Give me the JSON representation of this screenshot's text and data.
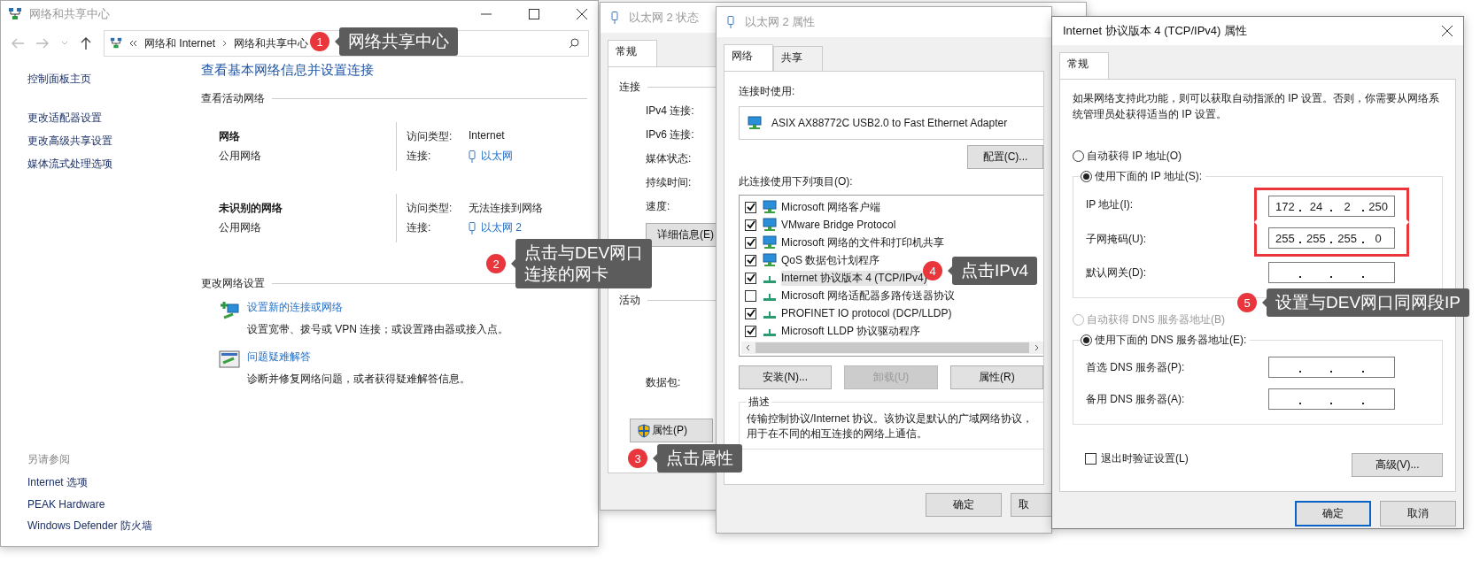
{
  "network_center": {
    "title": "网络和共享中心",
    "breadcrumb": [
      "网络和 Internet",
      "网络和共享中心"
    ],
    "sidebar": {
      "items": [
        "控制面板主页",
        "更改适配器设置",
        "更改高级共享设置",
        "媒体流式处理选项"
      ],
      "see_also_title": "另请参阅",
      "see_also": [
        "Internet 选项",
        "PEAK Hardware",
        "Windows Defender 防火墙"
      ]
    },
    "heading": "查看基本网络信息并设置连接",
    "active_title": "查看活动网络",
    "networks": [
      {
        "name": "网络",
        "type": "公用网络",
        "access_label": "访问类型:",
        "access_value": "Internet",
        "connection_label": "连接:",
        "connection_value": "以太网"
      },
      {
        "name": "未识别的网络",
        "type": "公用网络",
        "access_label": "访问类型:",
        "access_value": "无法连接到网络",
        "connection_label": "连接:",
        "connection_value": "以太网 2"
      }
    ],
    "change_title": "更改网络设置",
    "tasks": [
      {
        "kind": "new-connection",
        "link": "设置新的连接或网络",
        "description": "设置宽带、拨号或 VPN 连接；或设置路由器或接入点。"
      },
      {
        "kind": "troubleshoot",
        "link": "问题疑难解答",
        "description": "诊断并修复网络问题，或者获得疑难解答信息。"
      }
    ]
  },
  "status_dialog": {
    "title": "以太网 2 状态",
    "tabs": [
      {
        "label": "常规",
        "selected": true
      }
    ],
    "connection_group": "连接",
    "fields": [
      "IPv4 连接:",
      "IPv6 连接:",
      "媒体状态:",
      "持续时间:",
      "速度:"
    ],
    "details_button": "详细信息(E)",
    "activity_group": "活动",
    "packets_label": "数据包:",
    "properties_button": "属性(P)"
  },
  "properties_dialog": {
    "title": "以太网 2 属性",
    "tabs": [
      {
        "label": "网络",
        "selected": true
      },
      {
        "label": "共享",
        "selected": false
      }
    ],
    "connect_using_label": "连接时使用:",
    "adapter": "ASIX AX88772C USB2.0 to Fast Ethernet Adapter",
    "configure_button": "配置(C)...",
    "items_label": "此连接使用下列项目(O):",
    "items": [
      {
        "kind": "service",
        "label": "Microsoft 网络客户端",
        "checked": true,
        "selected": false
      },
      {
        "kind": "service",
        "label": "VMware Bridge Protocol",
        "checked": true,
        "selected": false
      },
      {
        "kind": "service",
        "label": "Microsoft 网络的文件和打印机共享",
        "checked": true,
        "selected": false
      },
      {
        "kind": "service",
        "label": "QoS 数据包计划程序",
        "checked": true,
        "selected": false
      },
      {
        "kind": "protocol",
        "label": "Internet 协议版本 4 (TCP/IPv4)",
        "checked": true,
        "selected": true
      },
      {
        "kind": "protocol",
        "label": "Microsoft 网络适配器多路传送器协议",
        "checked": false,
        "selected": false
      },
      {
        "kind": "protocol",
        "label": "PROFINET IO protocol (DCP/LLDP)",
        "checked": true,
        "selected": false
      },
      {
        "kind": "protocol",
        "label": "Microsoft LLDP 协议驱动程序",
        "checked": true,
        "selected": false
      }
    ],
    "buttons": [
      {
        "label": "安装(N)...",
        "disabled": false
      },
      {
        "label": "卸载(U)",
        "disabled": true
      },
      {
        "label": "属性(R)",
        "disabled": false
      }
    ],
    "description_title": "描述",
    "description": "传输控制协议/Internet 协议。该协议是默认的广域网络协议，用于在不同的相互连接的网络上通信。",
    "ok_button": "确定",
    "cancel_button": "取"
  },
  "ipv4_dialog": {
    "title": "Internet 协议版本 4 (TCP/IPv4) 属性",
    "tabs": [
      {
        "label": "常规",
        "selected": true
      }
    ],
    "intro": "如果网络支持此功能，则可以获取自动指派的 IP 设置。否则，你需要从网络系统管理员处获得适当的 IP 设置。",
    "ip_options": [
      {
        "label": "自动获得 IP 地址(O)",
        "selected": false,
        "disabled": false
      },
      {
        "label": "使用下面的 IP 地址(S):",
        "selected": true,
        "disabled": false
      }
    ],
    "ip_fields": [
      {
        "label": "IP 地址(I):",
        "octets": [
          "172",
          "24",
          "2",
          "250"
        ],
        "highlighted": true
      },
      {
        "label": "子网掩码(U):",
        "octets": [
          "255",
          "255",
          "255",
          "0"
        ],
        "highlighted": true
      },
      {
        "label": "默认网关(D):"
      }
    ],
    "dns_options": [
      {
        "label": "自动获得 DNS 服务器地址(B)",
        "selected": false,
        "disabled": true
      },
      {
        "label": "使用下面的 DNS 服务器地址(E):",
        "selected": true,
        "disabled": false
      }
    ],
    "dns_fields": [
      {
        "label": "首选 DNS 服务器(P):"
      },
      {
        "label": "备用 DNS 服务器(A):"
      }
    ],
    "validate": {
      "label": "退出时验证设置(L)",
      "checked": false
    },
    "advanced_button": "高级(V)...",
    "ok_button": "确定",
    "cancel_button": "取消"
  },
  "callouts": [
    {
      "number": "1",
      "lines": [
        "网络共享中心"
      ]
    },
    {
      "number": "2",
      "lines": [
        "点击与DEV网口",
        "连接的网卡"
      ]
    },
    {
      "number": "3",
      "lines": [
        "点击属性"
      ]
    },
    {
      "number": "4",
      "lines": [
        "点击IPv4"
      ]
    },
    {
      "number": "5",
      "lines": [
        "设置与DEV网口同网段IP"
      ]
    }
  ]
}
